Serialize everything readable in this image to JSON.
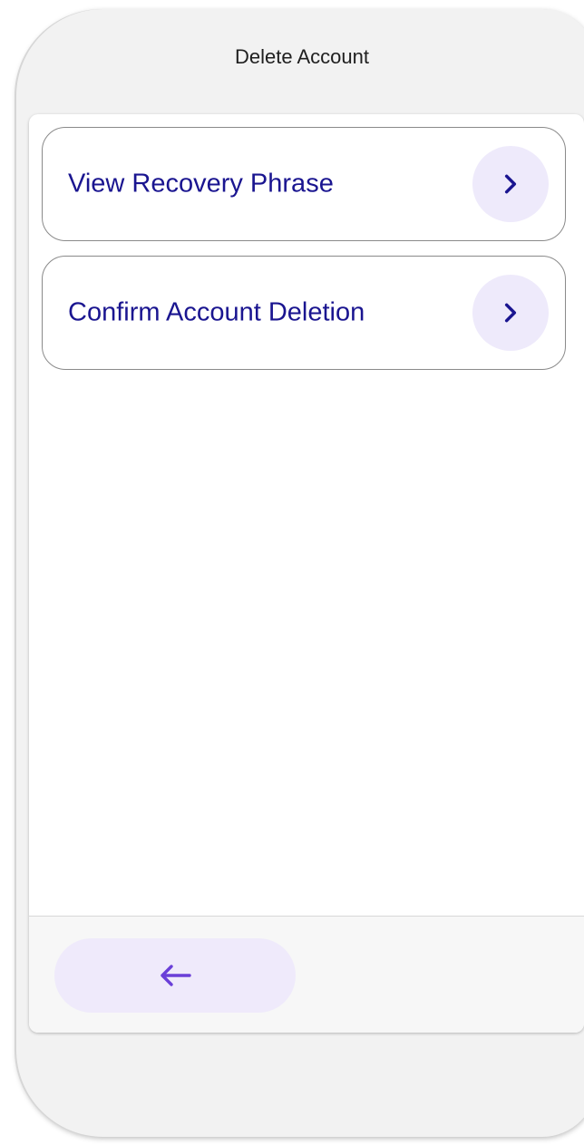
{
  "header": {
    "title": "Delete Account"
  },
  "menu": {
    "items": [
      {
        "label": "View Recovery Phrase",
        "icon": "chevron-right-icon"
      },
      {
        "label": "Confirm Account Deletion",
        "icon": "chevron-right-icon"
      }
    ]
  },
  "footer": {
    "back_icon": "arrow-left-icon"
  },
  "colors": {
    "label_text": "#1a1590",
    "chevron_bg": "#eeeafb",
    "chevron_fg": "#1a1590",
    "back_bg": "#efeafb",
    "back_arrow": "#6a3fd8"
  }
}
